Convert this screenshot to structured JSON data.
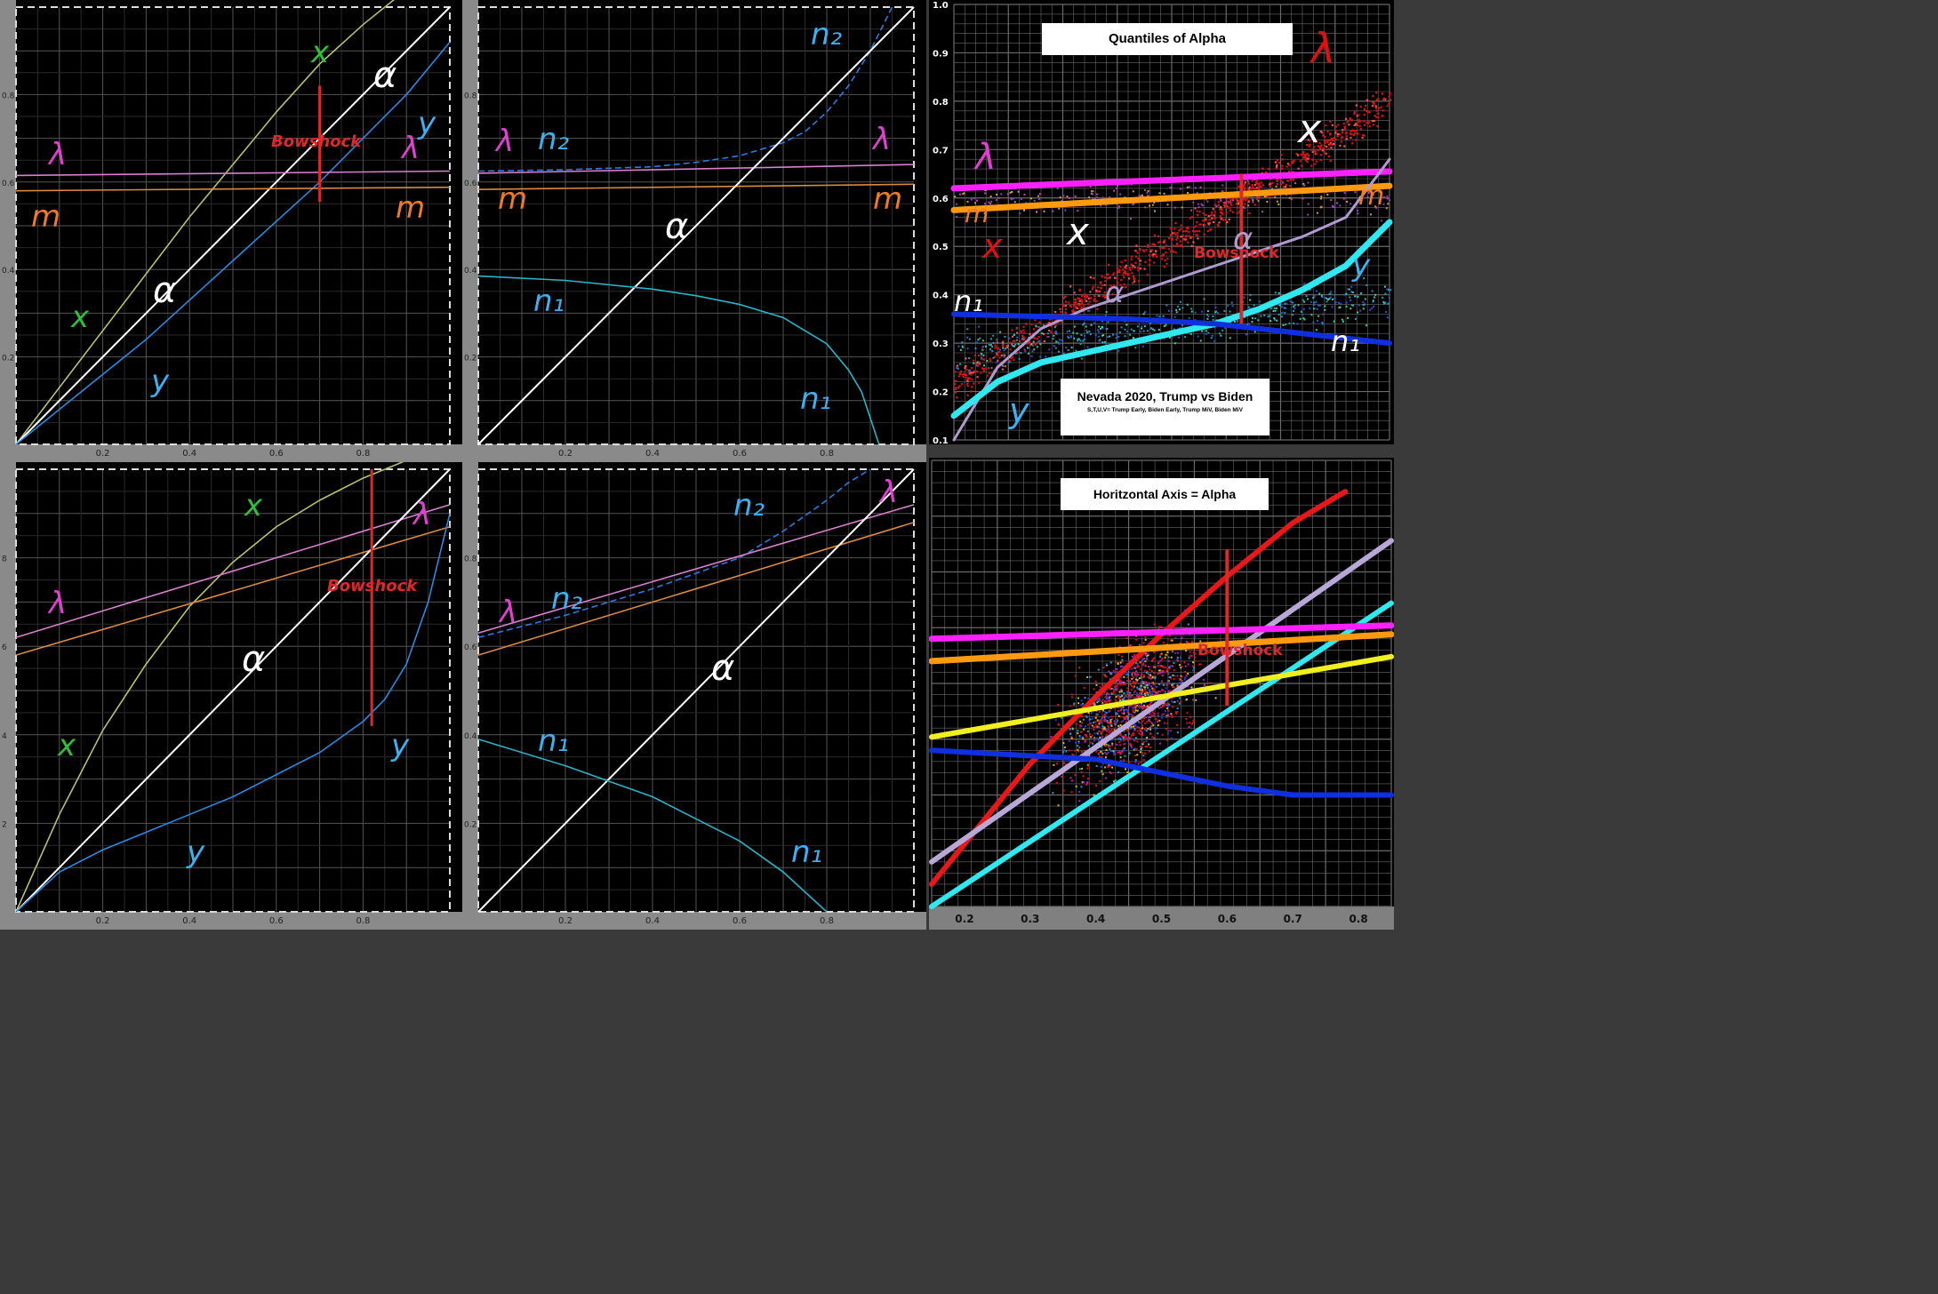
{
  "colors": {
    "lambda": "#d97fd0",
    "m": "#d98a3d",
    "x": "#b8c26a",
    "y": "#2a8ae0",
    "alpha": "#ffffff",
    "n1": "#27b5c8",
    "n2": "#2a7be0",
    "bowshock": "#e0282a",
    "label_green": "#2fbf3a",
    "label_magenta": "#e040d0",
    "label_orange": "#f07b20",
    "label_cyan": "#3cb0f0"
  },
  "annotations": {
    "bowshock": "Bowshock",
    "lambda": "λ",
    "m": "m",
    "x": "x",
    "y": "y",
    "alpha": "α",
    "n1": "n₁",
    "n2": "n₂"
  },
  "plots": [
    {
      "id": "top-left",
      "xticks": [
        "0.2",
        "0.4",
        "0.6",
        "0.8"
      ],
      "yticks": [
        "0.2",
        "0.4",
        "0.6",
        "0.8"
      ]
    },
    {
      "id": "top-middle",
      "xticks": [
        "0.2",
        "0.4",
        "0.6",
        "0.8"
      ],
      "yticks": [
        "0.2",
        "0.4",
        "0.6",
        "0.8"
      ]
    },
    {
      "id": "bottom-left",
      "xticks": [
        "0.2",
        "0.4",
        "0.6",
        "0.8"
      ],
      "yticks": [
        "2",
        "4",
        "6",
        "8"
      ]
    },
    {
      "id": "bottom-middle",
      "xticks": [
        "0.2",
        "0.4",
        "0.6",
        "0.8"
      ],
      "yticks": [
        "0.2",
        "0.4",
        "0.6",
        "0.8"
      ]
    }
  ],
  "right_top": {
    "title": "Quantiles of Alpha",
    "subtitle": "Nevada 2020, Trump vs Biden",
    "note": "S,T,U,V= Trump Early, Biden Early, Trump MiV, Biden MiV",
    "yticks": [
      "0.1",
      "0.2",
      "0.3",
      "0.4",
      "0.5",
      "0.6",
      "0.7",
      "0.8",
      "0.9",
      "1.0"
    ]
  },
  "right_bottom": {
    "title": "Horitzontal Axis = Alpha",
    "xticks": [
      "0.2",
      "0.3",
      "0.4",
      "0.5",
      "0.6",
      "0.7",
      "0.8"
    ]
  },
  "chart_data": [
    {
      "type": "line",
      "id": "top-left",
      "xlim": [
        0,
        1
      ],
      "ylim": [
        0,
        1
      ],
      "series": [
        {
          "name": "x",
          "x": [
            0,
            0.1,
            0.2,
            0.3,
            0.4,
            0.5,
            0.6,
            0.7,
            0.8,
            0.9,
            1.0
          ],
          "y": [
            0,
            0.13,
            0.26,
            0.39,
            0.52,
            0.64,
            0.76,
            0.87,
            0.96,
            1.04,
            1.1
          ]
        },
        {
          "name": "α",
          "x": [
            0,
            1
          ],
          "y": [
            0,
            1
          ]
        },
        {
          "name": "y",
          "x": [
            0,
            0.1,
            0.2,
            0.3,
            0.4,
            0.5,
            0.6,
            0.7,
            0.8,
            0.9,
            1.0
          ],
          "y": [
            0,
            0.08,
            0.16,
            0.24,
            0.33,
            0.42,
            0.51,
            0.6,
            0.7,
            0.8,
            0.92
          ]
        },
        {
          "name": "λ",
          "x": [
            0,
            1
          ],
          "y": [
            0.615,
            0.625
          ]
        },
        {
          "name": "m",
          "x": [
            0,
            1
          ],
          "y": [
            0.58,
            0.588
          ]
        }
      ],
      "bowshock": {
        "x": 0.7,
        "y0": 0.555,
        "y1": 0.82
      }
    },
    {
      "type": "line",
      "id": "top-middle",
      "xlim": [
        0,
        1
      ],
      "ylim": [
        0,
        1
      ],
      "series": [
        {
          "name": "n₂",
          "x": [
            0,
            0.2,
            0.4,
            0.5,
            0.6,
            0.7,
            0.75,
            0.8,
            0.85,
            0.9,
            0.93,
            0.95
          ],
          "y": [
            0.625,
            0.628,
            0.635,
            0.645,
            0.66,
            0.69,
            0.715,
            0.76,
            0.82,
            0.9,
            0.96,
            1.0
          ]
        },
        {
          "name": "λ",
          "x": [
            0,
            1
          ],
          "y": [
            0.62,
            0.64
          ]
        },
        {
          "name": "m",
          "x": [
            0,
            1
          ],
          "y": [
            0.583,
            0.595
          ]
        },
        {
          "name": "α",
          "x": [
            0,
            1
          ],
          "y": [
            0,
            1
          ]
        },
        {
          "name": "n₁",
          "x": [
            0,
            0.2,
            0.4,
            0.5,
            0.6,
            0.7,
            0.8,
            0.85,
            0.88,
            0.9,
            0.92
          ],
          "y": [
            0.385,
            0.375,
            0.355,
            0.34,
            0.32,
            0.29,
            0.23,
            0.17,
            0.12,
            0.06,
            0
          ]
        }
      ]
    },
    {
      "type": "line",
      "id": "bottom-left",
      "xlim": [
        0,
        1
      ],
      "ylim": [
        0,
        10
      ],
      "series": [
        {
          "name": "x",
          "x": [
            0,
            0.05,
            0.1,
            0.2,
            0.3,
            0.4,
            0.5,
            0.6,
            0.7,
            0.8,
            0.9
          ],
          "y": [
            0,
            1.1,
            2.2,
            4.1,
            5.6,
            6.9,
            7.9,
            8.7,
            9.3,
            9.8,
            10.2
          ]
        },
        {
          "name": "λ",
          "x": [
            0,
            1
          ],
          "y": [
            6.2,
            9.2
          ]
        },
        {
          "name": "m",
          "x": [
            0,
            1
          ],
          "y": [
            5.8,
            8.7
          ]
        },
        {
          "name": "α",
          "x": [
            0,
            1
          ],
          "y": [
            0,
            10
          ]
        },
        {
          "name": "y",
          "x": [
            0,
            0.1,
            0.2,
            0.3,
            0.4,
            0.5,
            0.6,
            0.7,
            0.8,
            0.85,
            0.9,
            0.95,
            1.0
          ],
          "y": [
            0,
            0.9,
            1.4,
            1.8,
            2.2,
            2.6,
            3.1,
            3.6,
            4.3,
            4.8,
            5.6,
            7.0,
            9.0
          ]
        }
      ],
      "bowshock": {
        "x": 0.82,
        "y0": 4.2,
        "y1": 10
      }
    },
    {
      "type": "line",
      "id": "bottom-middle",
      "xlim": [
        0,
        1
      ],
      "ylim": [
        0,
        1
      ],
      "series": [
        {
          "name": "n₂",
          "x": [
            0,
            0.2,
            0.4,
            0.6,
            0.7,
            0.8,
            0.85,
            0.9
          ],
          "y": [
            0.62,
            0.67,
            0.73,
            0.8,
            0.86,
            0.93,
            0.97,
            1.0
          ]
        },
        {
          "name": "λ",
          "x": [
            0,
            1
          ],
          "y": [
            0.63,
            0.92
          ]
        },
        {
          "name": "m",
          "x": [
            0,
            1
          ],
          "y": [
            0.58,
            0.88
          ]
        },
        {
          "name": "α",
          "x": [
            0,
            1
          ],
          "y": [
            0,
            1
          ]
        },
        {
          "name": "n₁",
          "x": [
            0,
            0.2,
            0.4,
            0.5,
            0.6,
            0.7,
            0.8
          ],
          "y": [
            0.39,
            0.33,
            0.26,
            0.21,
            0.16,
            0.09,
            0
          ]
        }
      ]
    },
    {
      "type": "scatter",
      "id": "quantiles-of-alpha",
      "title": "Quantiles of Alpha",
      "ylim": [
        0.1,
        1.0
      ],
      "series": [
        {
          "name": "λ",
          "x": [
            0,
            1
          ],
          "y": [
            0.62,
            0.655
          ]
        },
        {
          "name": "m",
          "x": [
            0,
            1
          ],
          "y": [
            0.575,
            0.625
          ]
        },
        {
          "name": "α",
          "x": [
            0,
            0.1,
            0.2,
            0.3,
            0.4,
            0.5,
            0.6,
            0.7,
            0.8,
            0.9,
            1.0
          ],
          "y": [
            0.1,
            0.25,
            0.33,
            0.37,
            0.4,
            0.43,
            0.46,
            0.49,
            0.52,
            0.56,
            0.68
          ]
        },
        {
          "name": "y",
          "x": [
            0,
            0.1,
            0.2,
            0.3,
            0.4,
            0.5,
            0.6,
            0.7,
            0.8,
            0.9,
            1.0
          ],
          "y": [
            0.15,
            0.22,
            0.26,
            0.28,
            0.3,
            0.32,
            0.34,
            0.37,
            0.41,
            0.46,
            0.55
          ]
        },
        {
          "name": "n₁",
          "x": [
            0,
            0.2,
            0.4,
            0.6,
            0.8,
            1.0
          ],
          "y": [
            0.36,
            0.355,
            0.35,
            0.34,
            0.32,
            0.3
          ]
        }
      ],
      "bowshock": {
        "x": 0.66,
        "y0": 0.34,
        "y1": 0.65
      }
    },
    {
      "type": "scatter",
      "id": "horizontal-axis-alpha",
      "title": "Horitzontal Axis = Alpha",
      "xlim": [
        0.15,
        0.85
      ],
      "series": [
        {
          "name": "red",
          "x": [
            0.15,
            0.3,
            0.4,
            0.5,
            0.6,
            0.7,
            0.78
          ],
          "y": [
            0.05,
            0.32,
            0.47,
            0.61,
            0.74,
            0.86,
            0.93
          ]
        },
        {
          "name": "lavender",
          "x": [
            0.15,
            0.85
          ],
          "y": [
            0.1,
            0.82
          ]
        },
        {
          "name": "cyan",
          "x": [
            0.15,
            0.85
          ],
          "y": [
            0.0,
            0.68
          ]
        },
        {
          "name": "magenta",
          "x": [
            0.15,
            0.85
          ],
          "y": [
            0.6,
            0.63
          ]
        },
        {
          "name": "orange",
          "x": [
            0.15,
            0.85
          ],
          "y": [
            0.55,
            0.61
          ]
        },
        {
          "name": "yellow",
          "x": [
            0.15,
            0.85
          ],
          "y": [
            0.38,
            0.56
          ]
        },
        {
          "name": "blue",
          "x": [
            0.15,
            0.4,
            0.5,
            0.6,
            0.7,
            0.85
          ],
          "y": [
            0.35,
            0.33,
            0.3,
            0.27,
            0.25,
            0.25
          ]
        }
      ],
      "bowshock": {
        "x": 0.6,
        "y0": 0.45,
        "y1": 0.8
      }
    }
  ]
}
